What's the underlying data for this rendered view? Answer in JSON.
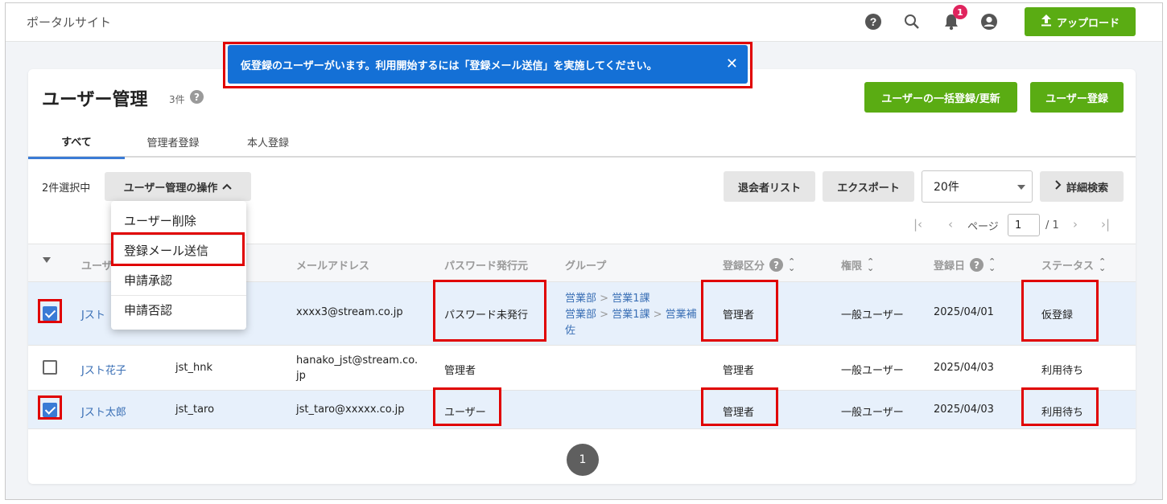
{
  "header": {
    "site_title": "ポータルサイト",
    "notification_count": "1",
    "upload_label": "アップロード",
    "icons": [
      "help-icon",
      "search-icon",
      "bell-icon",
      "account-icon",
      "upload-icon"
    ]
  },
  "toast": {
    "message": "仮登録のユーザーがいます。利用開始するには「登録メール送信」を実施してください。",
    "close": "✕"
  },
  "page": {
    "title": "ユーザー管理",
    "count": "3件",
    "bulk_button": "ユーザーの一括登録/更新",
    "register_button": "ユーザー登録"
  },
  "tabs": [
    {
      "label": "すべて",
      "active": true
    },
    {
      "label": "管理者登録",
      "active": false
    },
    {
      "label": "本人登録",
      "active": false
    }
  ],
  "toolbar": {
    "selected_count": "2件選択中",
    "ops_label": "ユーザー管理の操作",
    "leave_list": "退会者リスト",
    "export": "エクスポート",
    "per_page": "20件",
    "advanced_search": "詳細検索"
  },
  "pager": {
    "label": "ページ",
    "current": "1",
    "total": "/ 1"
  },
  "dropdown": {
    "items": [
      "ユーザー削除",
      "登録メール送信",
      "申請承認",
      "申請否認"
    ]
  },
  "table": {
    "headers": {
      "user": "ユーザー",
      "email": "メールアドレス",
      "password_issuer": "パスワード発行元",
      "group": "グループ",
      "registration_type": "登録区分",
      "role": "権限",
      "registered_date": "登録日",
      "status": "ステータス"
    },
    "rows": [
      {
        "checked": true,
        "name": "Jスト",
        "login_id": "",
        "email": "xxxx3@stream.co.jp",
        "password_issuer": "パスワード未発行",
        "groups": [
          {
            "a": "営業部",
            "sep": ">",
            "b": "営業1課",
            "sep2": "",
            "c": ""
          },
          {
            "a": "営業部",
            "sep": ">",
            "b": "営業1課",
            "sep2": ">",
            "c": "営業補"
          },
          {
            "a": "佐",
            "sep": "",
            "b": "",
            "sep2": "",
            "c": ""
          }
        ],
        "registration_type": "管理者",
        "role": "一般ユーザー",
        "date": "2025/04/01",
        "status": "仮登録"
      },
      {
        "checked": false,
        "name": "Jスト花子",
        "login_id": "jst_hnk",
        "email_line1": "hanako_jst@stream.co.",
        "email_line2": "jp",
        "password_issuer": "管理者",
        "registration_type": "管理者",
        "role": "一般ユーザー",
        "date": "2025/04/03",
        "status": "利用待ち"
      },
      {
        "checked": true,
        "name": "Jスト太郎",
        "login_id": "jst_taro",
        "email": "jst_taro@xxxxx.co.jp",
        "password_issuer": "ユーザー",
        "registration_type": "管理者",
        "role": "一般ユーザー",
        "date": "2025/04/03",
        "status": "利用待ち"
      }
    ]
  },
  "pagination": {
    "current": "1"
  },
  "colors": {
    "accent_green": "#5aac13",
    "toast_blue": "#1470d6",
    "highlight_red": "#e00000",
    "badge_red": "#e0245e"
  }
}
